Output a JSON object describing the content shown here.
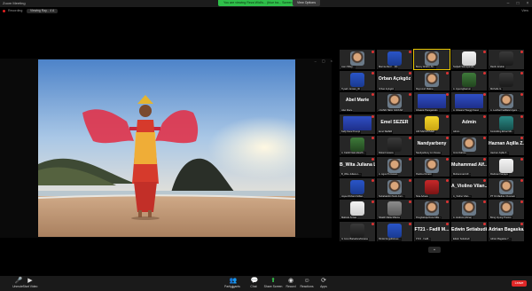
{
  "window": {
    "app_title": "Zoom Meeting"
  },
  "share_banner": {
    "text": "You are viewing Reza Widi's... (blue ba... Screen Share)"
  },
  "view_options": {
    "label": "View Options"
  },
  "status": {
    "recording_label": "Recording",
    "viewing_label": "Viewing Ray... 4 A",
    "view_button": "View"
  },
  "gallery": {
    "tiles": [
      {
        "name": "Liam Wiley...",
        "big": "",
        "face": "skin",
        "active": false,
        "muted": true
      },
      {
        "name": "Marnia Alexz... (D)",
        "big": "",
        "face": "blue",
        "active": false,
        "muted": true
      },
      {
        "name": "Benny Ahaful, Ali...",
        "big": "",
        "face": "skin",
        "active": true,
        "muted": false
      },
      {
        "name": "Sudjadi Sarsopanda",
        "big": "",
        "face": "white",
        "active": false,
        "muted": true
      },
      {
        "name": "Ranik Jerebio",
        "big": "",
        "face": "dark",
        "active": false,
        "muted": true
      },
      {
        "name": "Tiyaah Jensen_ID",
        "big": "",
        "face": "blue",
        "active": false,
        "muted": true
      },
      {
        "name": "Orban Açıkgöz",
        "big": "Orban Açıkgöz",
        "face": "",
        "active": false,
        "muted": true
      },
      {
        "name": "Reymond Malina",
        "big": "",
        "face": "skin",
        "active": false,
        "muted": true
      },
      {
        "name": "A. Ayeongbaerun",
        "big": "",
        "face": "green",
        "active": false,
        "muted": true
      },
      {
        "name": "Michelle G.",
        "big": "",
        "face": "dark",
        "active": false,
        "muted": true
      },
      {
        "name": "Abel Marie",
        "big": "Abel Marie",
        "face": "",
        "active": false,
        "muted": true
      },
      {
        "name": "2 EVEN SEGI SAKKAR",
        "big": "",
        "face": "skin",
        "active": false,
        "muted": true
      },
      {
        "name": "Ghearat Pacagamalo",
        "big": "",
        "face": "slide",
        "active": false,
        "muted": true
      },
      {
        "name": "A. Ghearat Tiauggi Kasur",
        "big": "",
        "face": "slide",
        "active": false,
        "muted": true
      },
      {
        "name": "A. Leolhat Fadlilatul Agam...",
        "big": "",
        "face": "skin",
        "active": false,
        "muted": true
      },
      {
        "name": "Kelly Nora Prompt",
        "big": "",
        "face": "slide",
        "active": false,
        "muted": true
      },
      {
        "name": "Emel SEZER",
        "big": "Emel SEZER",
        "face": "",
        "active": false,
        "muted": true
      },
      {
        "name": "ADI SAKSITISARI",
        "big": "",
        "face": "yellow",
        "active": false,
        "muted": true
      },
      {
        "name": "Admin",
        "big": "Admin",
        "face": "",
        "active": false,
        "muted": true
      },
      {
        "name": "Kontrolling Elmar Mo...",
        "big": "",
        "face": "teal",
        "active": false,
        "muted": true
      },
      {
        "name": "A. Kahdi Natundsorth...",
        "big": "",
        "face": "green",
        "active": false,
        "muted": true
      },
      {
        "name": "Robert Hereze",
        "big": "",
        "face": "dark",
        "active": false,
        "muted": true
      },
      {
        "name": "Nandyarbeny Lin Dessa",
        "big": "Nandyarbeny",
        "face": "",
        "active": false,
        "muted": true
      },
      {
        "name": "Irmis Dahwa",
        "big": "",
        "face": "skin",
        "active": false,
        "muted": true
      },
      {
        "name": "Haznan Aqilla Z...",
        "big": "Haznan Aqilla Z...",
        "face": "",
        "active": false,
        "muted": true
      },
      {
        "name": "B_Wita Juliana L...",
        "big": "B_Wita Juliana L...",
        "face": "",
        "active": false,
        "muted": true
      },
      {
        "name": "A. Agus Purnawan",
        "big": "",
        "face": "skin",
        "active": false,
        "muted": true
      },
      {
        "name": "Paulina Kiniaini",
        "big": "",
        "face": "skin",
        "active": false,
        "muted": true
      },
      {
        "name": "Muhammad Alf...",
        "big": "Muhammad Alf...",
        "face": "",
        "active": false,
        "muted": true
      },
      {
        "name": "Rodman Fanjaya",
        "big": "",
        "face": "white",
        "active": false,
        "muted": true
      },
      {
        "name": "Jayse Richard Gillian",
        "big": "",
        "face": "blue",
        "active": false,
        "muted": true
      },
      {
        "name": "Nuhahainibit Nodo Fari...",
        "big": "",
        "face": "skin",
        "active": false,
        "muted": true
      },
      {
        "name": "Sina Adowa",
        "big": "",
        "face": "red",
        "active": false,
        "muted": true
      },
      {
        "name": "A_Violino Vilan...",
        "big": "A_Violino Vilan...",
        "face": "",
        "active": false,
        "muted": true
      },
      {
        "name": "PT 01 Madina Chusnani",
        "big": "",
        "face": "skin",
        "active": false,
        "muted": true
      },
      {
        "name": "Malindo Annas",
        "big": "",
        "face": "white",
        "active": false,
        "muted": true
      },
      {
        "name": "Shaikh Malia Rifanta",
        "big": "",
        "face": "grey",
        "active": false,
        "muted": true
      },
      {
        "name": "Pongitaluqa Duna Mila...",
        "big": "",
        "face": "skin",
        "active": false,
        "muted": true
      },
      {
        "name": "A. Andrew (Alima)",
        "big": "",
        "face": "skin",
        "active": false,
        "muted": true
      },
      {
        "name": "Bong Hyung Tinomo",
        "big": "",
        "face": "skin",
        "active": false,
        "muted": true
      },
      {
        "name": "G Coco Bariadora/Grassa",
        "big": "",
        "face": "dark",
        "active": false,
        "muted": true
      },
      {
        "name": "Rindel Angelito/Lau...",
        "big": "",
        "face": "blue",
        "active": false,
        "muted": true
      },
      {
        "name": "FT21 - FadlI...",
        "big": "FT21 - FadlI M...",
        "face": "",
        "active": false,
        "muted": true
      },
      {
        "name": "Edwin Setiabudi",
        "big": "Edwin Setiabudi",
        "face": "",
        "active": false,
        "muted": true
      },
      {
        "name": "Adrian Bagaska Y...",
        "big": "Adrian Bagaska...",
        "face": "",
        "active": false,
        "muted": true
      }
    ]
  },
  "page_next": {
    "label": "⌄"
  },
  "toolbar": {
    "unmute_label": "Unmute",
    "start_video_label": "Start Video",
    "participants_label": "Participants",
    "participants_count": "226",
    "chat_label": "Chat",
    "share_label": "Share Screen",
    "record_label": "Record",
    "reactions_label": "Reactions",
    "apps_label": "Apps",
    "end_label": "Leave"
  }
}
